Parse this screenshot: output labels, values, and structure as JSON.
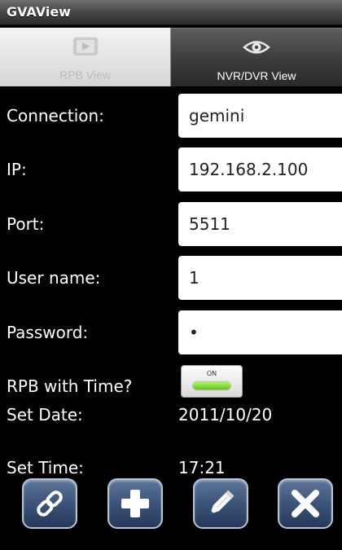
{
  "app": {
    "title": "GVAView"
  },
  "tabs": [
    {
      "label": "RPB View",
      "icon": "play-icon",
      "selected": true
    },
    {
      "label": "NVR/DVR View",
      "icon": "eye-icon",
      "selected": false
    }
  ],
  "form": {
    "connection": {
      "label": "Connection:",
      "value": "gemini"
    },
    "ip": {
      "label": "IP:",
      "value": "192.168.2.100"
    },
    "port": {
      "label": "Port:",
      "value": "5511"
    },
    "username": {
      "label": "User name:",
      "value": "1"
    },
    "password": {
      "label": "Password:",
      "value": "•"
    }
  },
  "rpb_time": {
    "label": "RPB with Time?",
    "toggle_text": "ON",
    "enabled": true
  },
  "set_date": {
    "label": "Set Date:",
    "value": "2011/10/20"
  },
  "set_time": {
    "label": "Set Time:",
    "value": "17:21"
  },
  "toolbar": [
    {
      "icon": "link-icon"
    },
    {
      "icon": "plus-icon"
    },
    {
      "icon": "pencil-icon"
    },
    {
      "icon": "close-icon"
    }
  ],
  "colors": {
    "background": "#000000",
    "input_background": "#ffffff",
    "toggle_on": "#5fc318",
    "button_base": "#3b5478"
  }
}
